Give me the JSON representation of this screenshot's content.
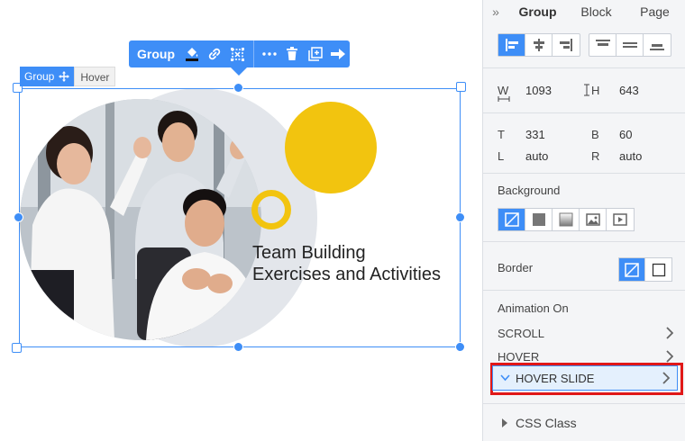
{
  "toolbar": {
    "label": "Group"
  },
  "element_tag": {
    "label": "Group",
    "state": "Hover"
  },
  "headline": {
    "line1": "Team Building",
    "line2": "Exercises and Activities"
  },
  "panel": {
    "tabs": [
      "Group",
      "Block",
      "Page"
    ],
    "size": {
      "w_label": "W",
      "w_value": "1093",
      "h_label": "H",
      "h_value": "643"
    },
    "position": {
      "t_label": "T",
      "t_value": "331",
      "b_label": "B",
      "b_value": "60",
      "l_label": "L",
      "l_value": "auto",
      "r_label": "R",
      "r_value": "auto"
    },
    "background_title": "Background",
    "border_title": "Border",
    "animation_title": "Animation On",
    "animation_items": [
      "SCROLL",
      "HOVER",
      "HOVER SLIDE"
    ],
    "css_class": "CSS Class"
  },
  "colors": {
    "accent": "#3e8ef7",
    "yellow": "#f2c40f",
    "highlight": "#e01818",
    "circle_gray": "#e3e6eb"
  }
}
